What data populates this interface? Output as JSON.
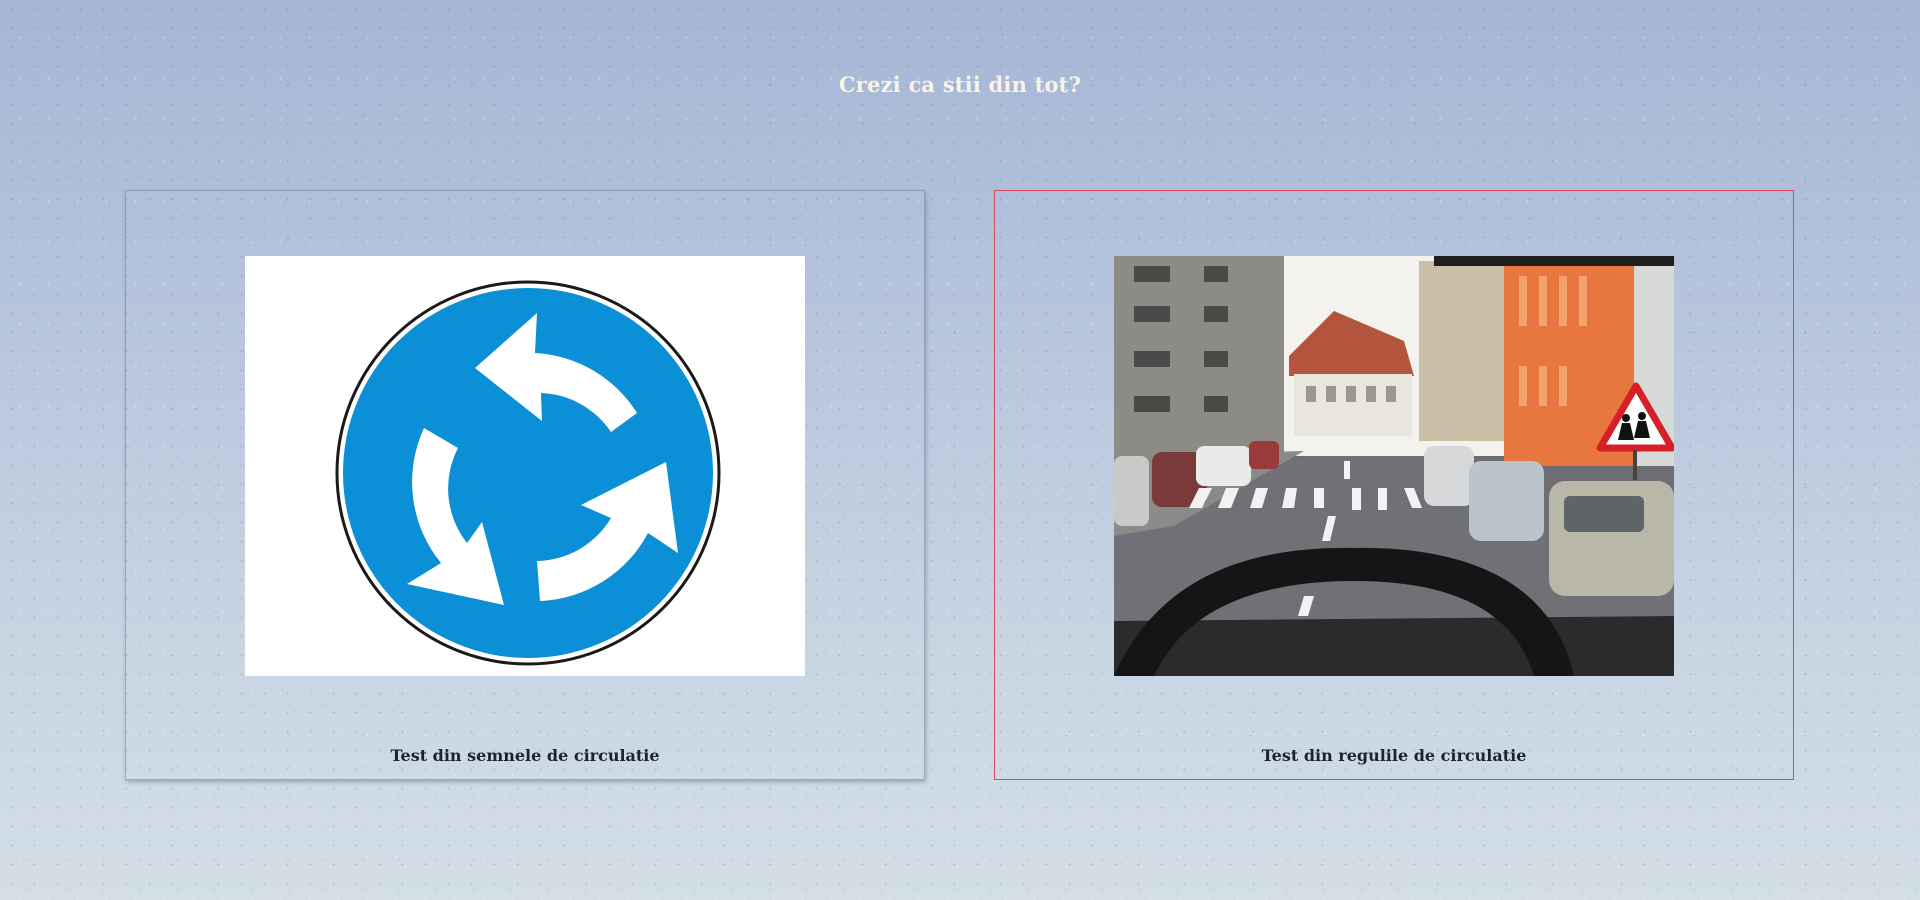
{
  "page": {
    "title": "Crezi ca stii din tot?"
  },
  "cards": [
    {
      "label": "Test din semnele de circulatie",
      "image": "roundabout-sign-icon"
    },
    {
      "label": "Test din regulile de circulatie",
      "image": "street-view-from-car"
    }
  ],
  "colors": {
    "title": "#fbf3e4",
    "active_border": "#d64a5a",
    "sign_blue": "#0b8fd6"
  }
}
